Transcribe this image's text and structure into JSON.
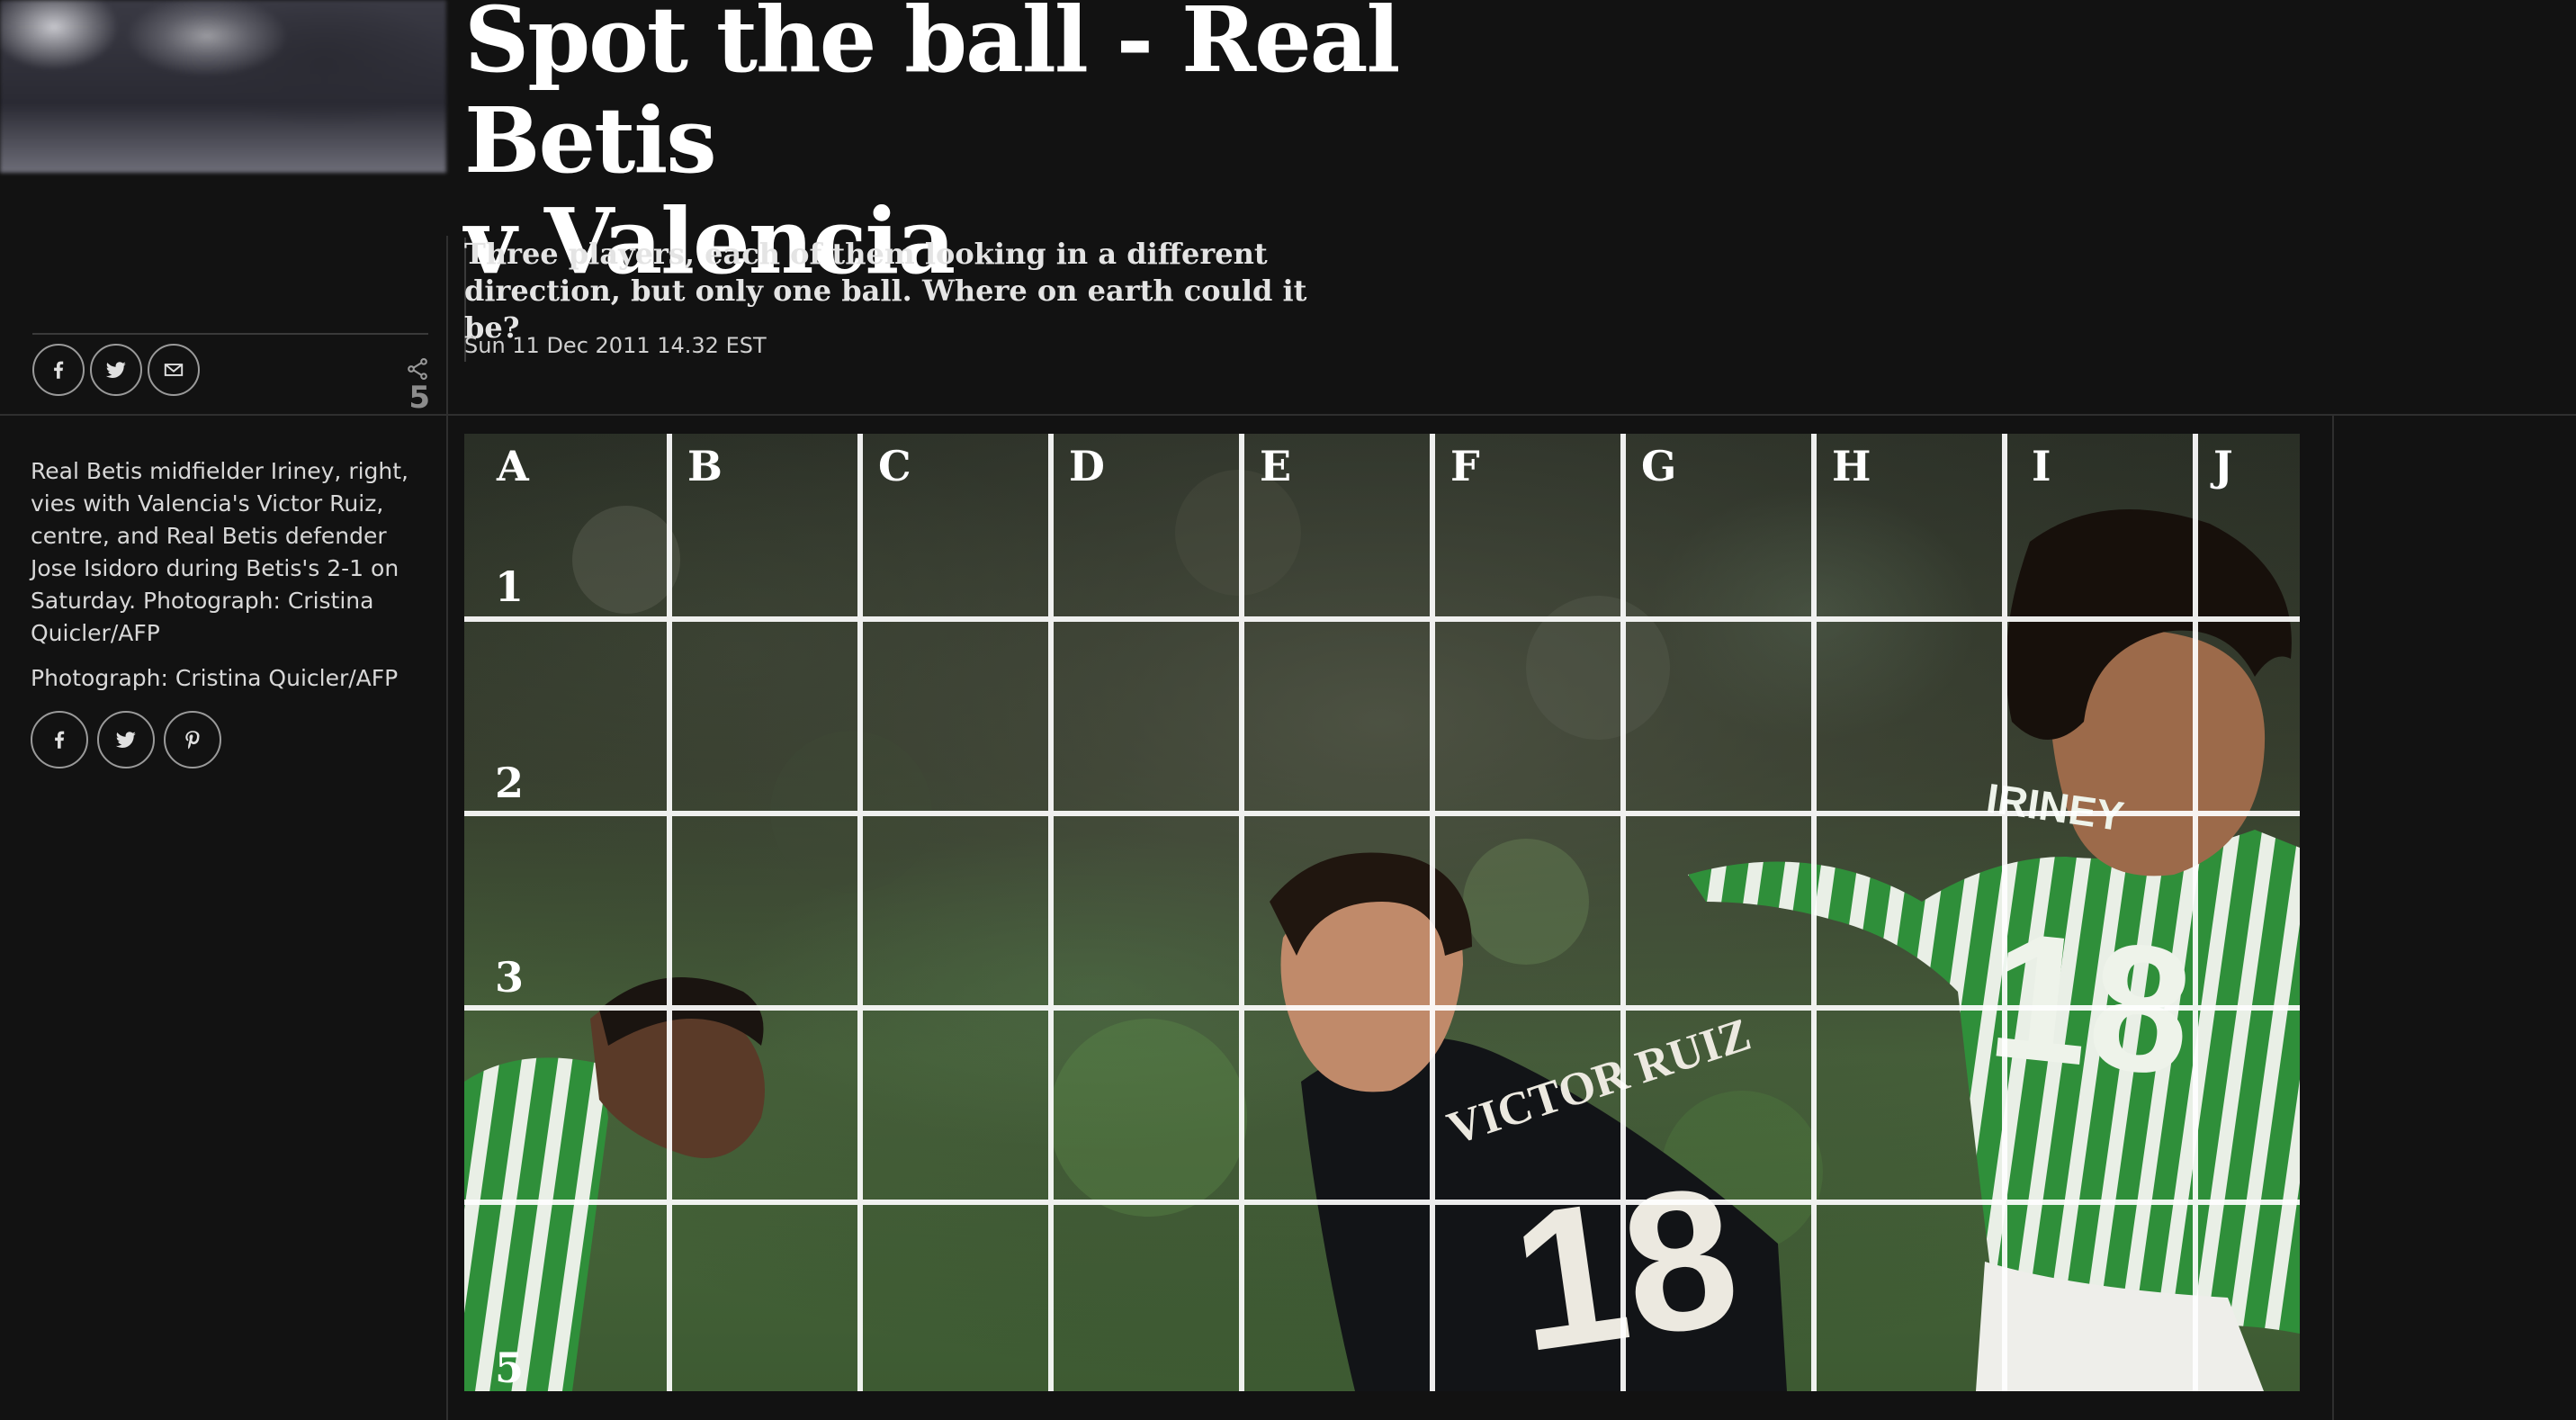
{
  "headline": "Spot the ball - Real Betis v Valencia",
  "headline_line1": "Spot the ball - Real Betis",
  "headline_line2": "v Valencia",
  "standfirst_line1": "Three players, each of them looking in a different",
  "standfirst_line2": "direction, but only one ball. Where on earth could it be?",
  "dateline": "Sun 11 Dec 2011 14.32 EST",
  "share": {
    "count": "5",
    "buttons": [
      "facebook-icon",
      "twitter-icon",
      "email-icon"
    ]
  },
  "caption": {
    "text": "Real Betis midfielder Iriney, right, vies with Valencia's Victor Ruiz, centre, and Real Betis defender Jose Isidoro during Betis's 2-1 on Saturday. Photograph: Cristina Quicler/AFP",
    "credit": "Photograph: Cristina Quicler/AFP",
    "share_buttons": [
      "facebook-icon",
      "twitter-icon",
      "pinterest-icon"
    ]
  },
  "photo": {
    "column_labels": [
      "A",
      "B",
      "C",
      "D",
      "E",
      "F",
      "G",
      "H",
      "I",
      "J"
    ],
    "row_labels": [
      "1",
      "2",
      "3",
      "5"
    ],
    "shirt_text": [
      "VICTOR RUIZ",
      "18",
      "IRINEY",
      "18"
    ]
  },
  "colors": {
    "background": "#121212",
    "headline": "#ffffff",
    "grid": "#ffffff",
    "betis_green": "#2f8f3a"
  }
}
